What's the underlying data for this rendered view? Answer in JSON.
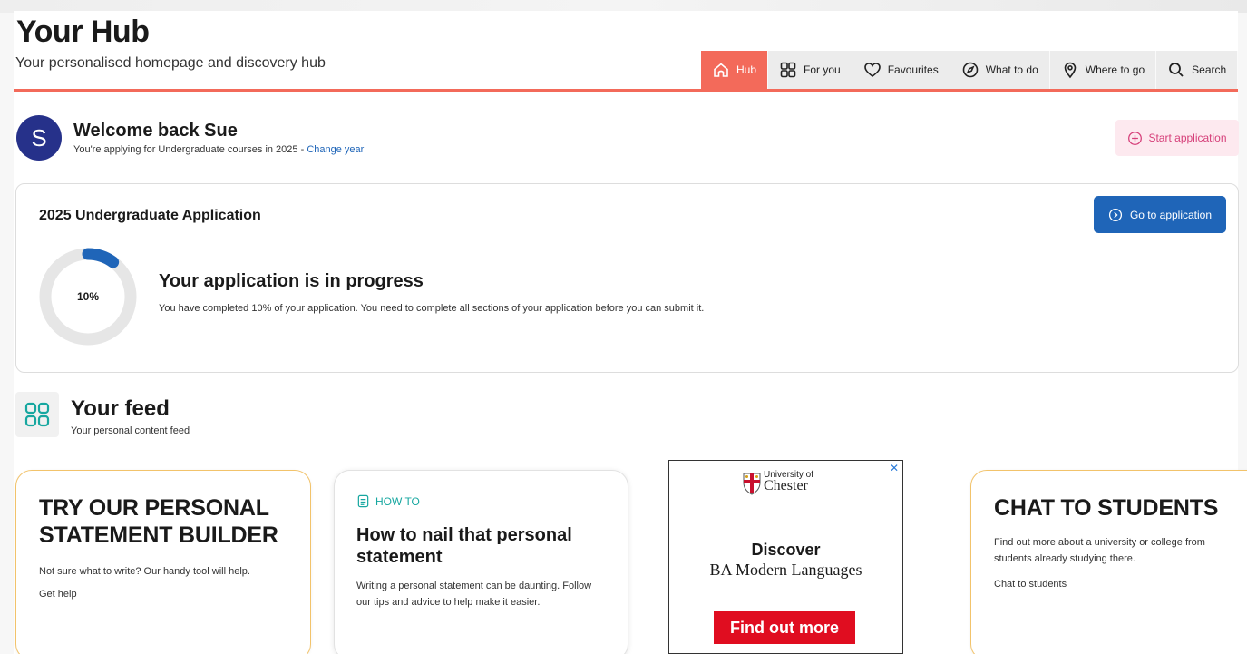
{
  "header": {
    "title": "Your Hub",
    "subtitle": "Your personalised homepage and discovery hub"
  },
  "nav": {
    "tabs": [
      {
        "label": "Hub",
        "icon": "home-icon",
        "active": true
      },
      {
        "label": "For you",
        "icon": "grid-icon"
      },
      {
        "label": "Favourites",
        "icon": "heart-icon"
      },
      {
        "label": "What to do",
        "icon": "compass-icon"
      },
      {
        "label": "Where to go",
        "icon": "map-pin-icon"
      },
      {
        "label": "Search",
        "icon": "search-icon"
      }
    ]
  },
  "welcome": {
    "avatar_initial": "S",
    "heading": "Welcome back Sue",
    "applying_text": "You're applying for Undergraduate courses in 2025 - ",
    "change_year": "Change year",
    "start_application": "Start application"
  },
  "application": {
    "heading": "2025 Undergraduate Application",
    "go_button": "Go to application",
    "progress_percent": 10,
    "progress_label": "10%",
    "status_title": "Your application is in progress",
    "status_desc": "You have completed 10% of your application. You need to complete all sections of your application before you can submit it."
  },
  "feed": {
    "title": "Your feed",
    "subtitle": "Your personal content feed",
    "cards": [
      {
        "heading": "TRY OUR PERSONAL STATEMENT BUILDER",
        "text": "Not sure what to write? Our handy tool will help.",
        "link": "Get help"
      },
      {
        "tag": "HOW TO",
        "heading": "How to nail that personal statement",
        "text": "Writing a personal statement can be daunting. Follow our tips and advice to help make it easier."
      },
      {
        "heading": "CHAT TO STUDENTS",
        "text": "Find out more about a university or college from students already studying there.",
        "link": "Chat to students"
      }
    ]
  },
  "ad": {
    "close": "✕",
    "university_of": "University of",
    "university_name": "Chester",
    "discover": "Discover",
    "course": "BA Modern Languages",
    "button": "Find out more"
  },
  "colors": {
    "accent": "#f36a5a",
    "primary_blue": "#1f65b8",
    "avatar": "#26318a",
    "feed_teal": "#17a7a0",
    "card_border": "#f2c36b",
    "ad_red": "#e00d20"
  }
}
